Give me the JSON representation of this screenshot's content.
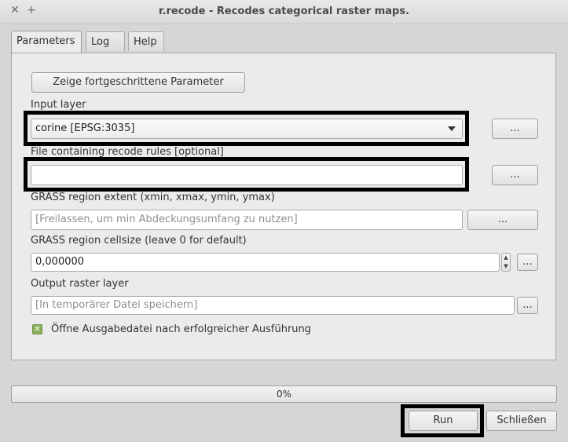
{
  "window": {
    "title": "r.recode - Recodes categorical raster maps.",
    "close_glyph": "✕",
    "add_glyph": "+"
  },
  "tabs": [
    {
      "label": "Parameters",
      "active": true
    },
    {
      "label": "Log",
      "active": false
    },
    {
      "label": "Help",
      "active": false
    }
  ],
  "advanced_button": "Zeige fortgeschrittene Parameter",
  "input_layer": {
    "label": "Input layer",
    "value": "corine [EPSG:3035]",
    "browse": "..."
  },
  "rules_file": {
    "label": "File containing recode rules [optional]",
    "value": "",
    "browse": "..."
  },
  "region_extent": {
    "label": "GRASS region extent (xmin, xmax, ymin, ymax)",
    "placeholder": "[Freilassen, um min Abdeckungsumfang zu nutzen]",
    "browse": "..."
  },
  "cellsize": {
    "label": "GRASS region cellsize (leave 0 for default)",
    "value": "0,000000",
    "browse": "..."
  },
  "output_layer": {
    "label": "Output raster layer",
    "placeholder": "[In temporärer Datei speichern]",
    "browse": "..."
  },
  "open_output": {
    "label": "Öffne Ausgabedatei nach erfolgreicher Ausführung",
    "checked": true
  },
  "progress": {
    "percent_text": "0%",
    "value": 0
  },
  "buttons": {
    "run": "Run",
    "close": "Schließen"
  },
  "colors": {
    "highlight": "#000000",
    "checkbox": "#8bb05c",
    "background": "#d6d6d6"
  }
}
